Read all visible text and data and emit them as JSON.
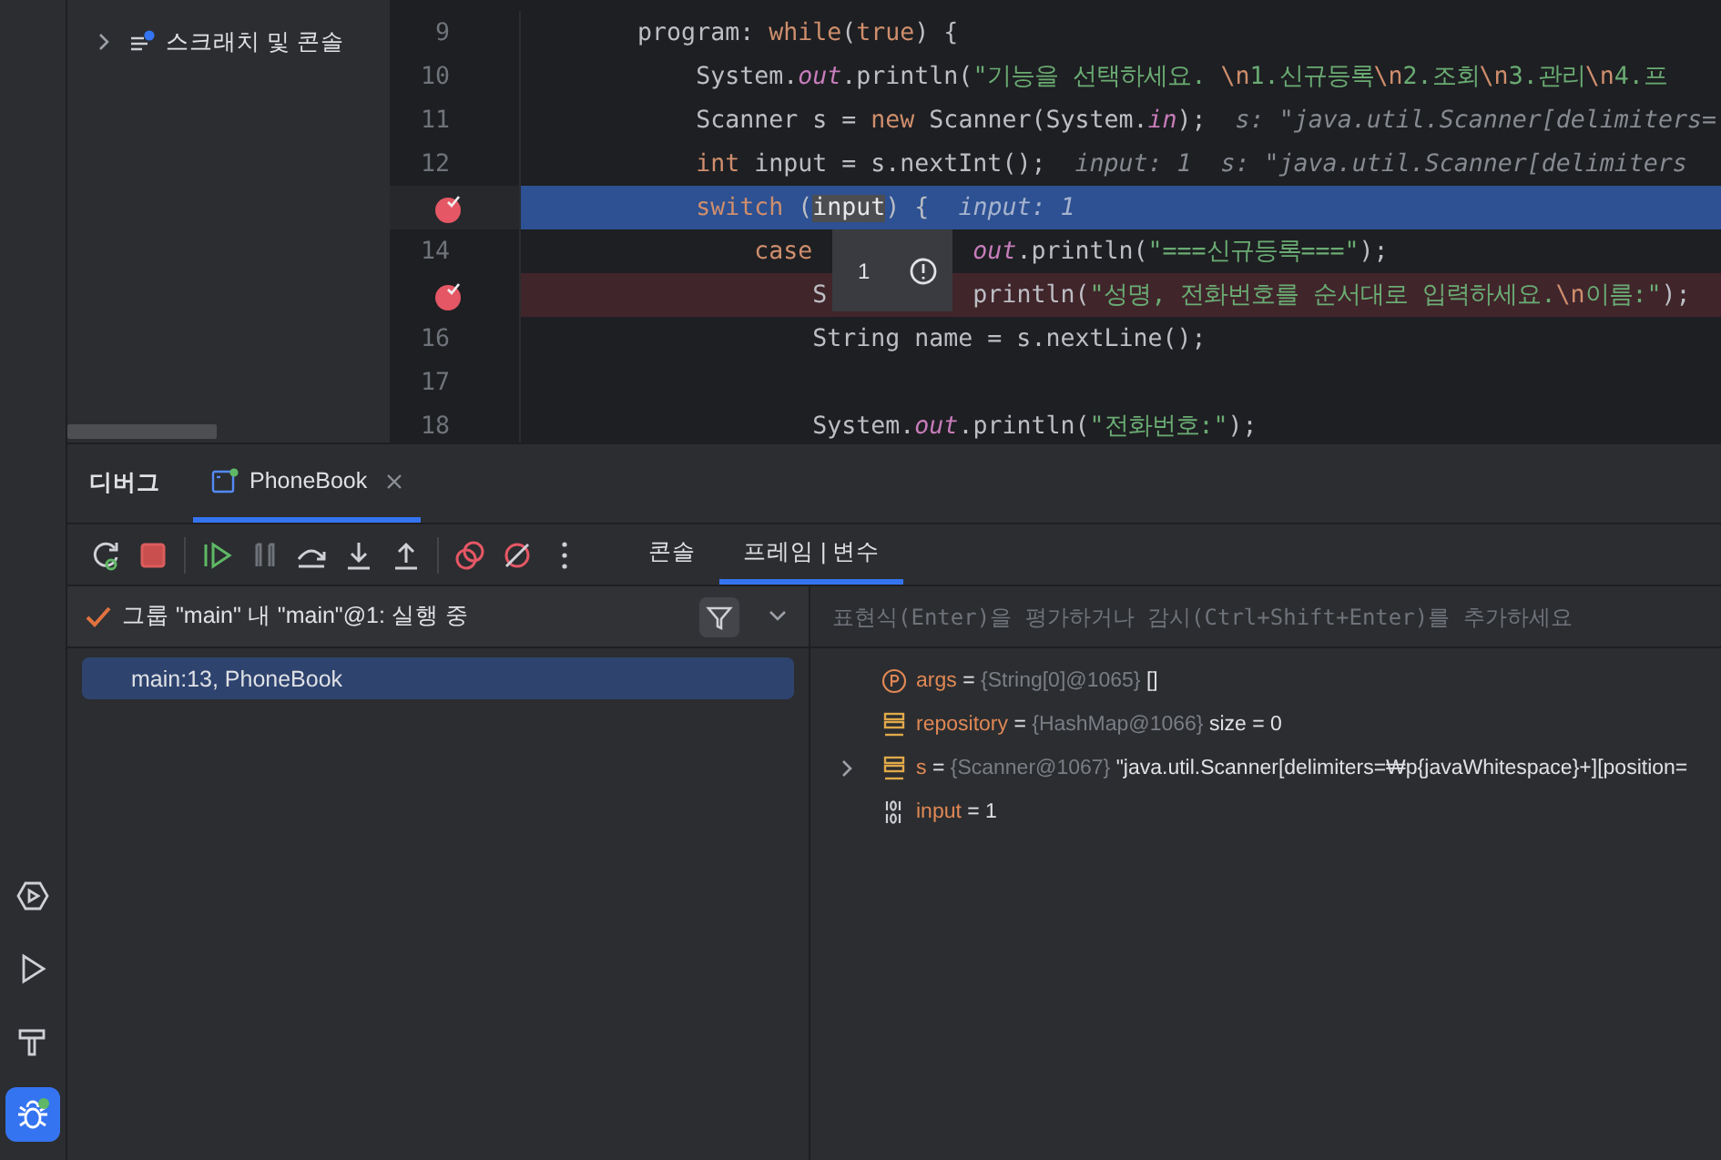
{
  "tool_strip": [
    {
      "kind": "services",
      "selected": false
    },
    {
      "kind": "run",
      "selected": false
    },
    {
      "kind": "build",
      "selected": false
    },
    {
      "kind": "debug",
      "selected": true
    }
  ],
  "project_tree": [
    {
      "label": "스크래치 및 콘솔",
      "kind": "scratch",
      "expanded": false
    }
  ],
  "editor": {
    "lines": [
      {
        "number": "9",
        "breakpoint": false,
        "execution_point": false,
        "tokens": [
          {
            "text": "        program: ",
            "kind": "plain"
          },
          {
            "text": "while",
            "kind": "keyword"
          },
          {
            "text": "(",
            "kind": "plain"
          },
          {
            "text": "true",
            "kind": "keyword"
          },
          {
            "text": ") {",
            "kind": "plain"
          }
        ]
      },
      {
        "number": "10",
        "breakpoint": false,
        "execution_point": false,
        "tokens": [
          {
            "text": "            System.",
            "kind": "plain"
          },
          {
            "text": "out",
            "kind": "field"
          },
          {
            "text": ".println(",
            "kind": "plain"
          },
          {
            "text": "\"기능을 선택하세요. ",
            "kind": "string"
          },
          {
            "text": "\\n",
            "kind": "escape"
          },
          {
            "text": "1.신규등록",
            "kind": "string"
          },
          {
            "text": "\\n",
            "kind": "escape"
          },
          {
            "text": "2.조회",
            "kind": "string"
          },
          {
            "text": "\\n",
            "kind": "escape"
          },
          {
            "text": "3.관리",
            "kind": "string"
          },
          {
            "text": "\\n",
            "kind": "escape"
          },
          {
            "text": "4.프",
            "kind": "string"
          }
        ]
      },
      {
        "number": "11",
        "breakpoint": false,
        "execution_point": false,
        "tokens": [
          {
            "text": "            Scanner s = ",
            "kind": "plain"
          },
          {
            "text": "new",
            "kind": "keyword"
          },
          {
            "text": " Scanner(System.",
            "kind": "plain"
          },
          {
            "text": "in",
            "kind": "field"
          },
          {
            "text": ");",
            "kind": "plain"
          },
          {
            "text": "s: \"java.util.Scanner[delimiters=",
            "kind": "hint"
          }
        ]
      },
      {
        "number": "12",
        "breakpoint": false,
        "execution_point": false,
        "tokens": [
          {
            "text": "            int",
            "kind": "keyword"
          },
          {
            "text": " input = s.nextInt();",
            "kind": "plain"
          },
          {
            "text": "input: 1",
            "kind": "hint"
          },
          {
            "text": "s: \"java.util.Scanner[delimiters",
            "kind": "hint"
          }
        ]
      },
      {
        "breakpoint": true,
        "execution_point": true,
        "tokens": [
          {
            "text": "            switch",
            "kind": "keyword"
          },
          {
            "text": " (",
            "kind": "plain"
          },
          {
            "text": "input",
            "kind": "hovered"
          },
          {
            "text": ") {",
            "kind": "plain"
          },
          {
            "text": "input: 1",
            "kind": "hint"
          }
        ]
      },
      {
        "number": "14",
        "breakpoint": false,
        "execution_point": false,
        "tokens": [
          {
            "text": "                case",
            "kind": "keyword"
          },
          {
            "text": "out",
            "kind": "field",
            "gap": true
          },
          {
            "text": ".println(",
            "kind": "plain"
          },
          {
            "text": "\"===신규등록===\"",
            "kind": "string"
          },
          {
            "text": ");",
            "kind": "plain"
          }
        ]
      },
      {
        "breakpoint": true,
        "execution_point": false,
        "tokens": [
          {
            "text": "                    S",
            "kind": "plain"
          },
          {
            "text": "println(",
            "kind": "plain",
            "gap": true
          },
          {
            "text": "\"성명, 전화번호를 순서대로 입력하세요.",
            "kind": "string"
          },
          {
            "text": "\\n",
            "kind": "escape"
          },
          {
            "text": "이름:\"",
            "kind": "string"
          },
          {
            "text": ");",
            "kind": "plain"
          }
        ]
      },
      {
        "number": "16",
        "breakpoint": false,
        "execution_point": false,
        "tokens": [
          {
            "text": "                    String name = s.nextLine();",
            "kind": "plain"
          }
        ]
      },
      {
        "number": "17",
        "breakpoint": false,
        "execution_point": false
      },
      {
        "number": "18",
        "breakpoint": false,
        "execution_point": false,
        "tokens": [
          {
            "text": "                    System.",
            "kind": "plain"
          },
          {
            "text": "out",
            "kind": "field"
          },
          {
            "text": ".println(",
            "kind": "plain"
          },
          {
            "text": "\"전화번호:\"",
            "kind": "string"
          },
          {
            "text": ");",
            "kind": "plain"
          }
        ]
      }
    ],
    "value_popup": {
      "value": "1"
    }
  },
  "debug_panel": {
    "title": "디버그",
    "session_tab": {
      "label": "PhoneBook",
      "selected": true
    },
    "toolbar": [
      {
        "kind": "rerun"
      },
      {
        "kind": "stop"
      },
      {
        "kind": "resume"
      },
      {
        "kind": "pause"
      },
      {
        "kind": "step-over"
      },
      {
        "kind": "step-into"
      },
      {
        "kind": "step-out"
      },
      {
        "kind": "breakpoints"
      },
      {
        "kind": "mute"
      },
      {
        "kind": "more"
      }
    ],
    "tabs": [
      {
        "label": "콘솔",
        "selected": false
      },
      {
        "label": "프레임 | 변수",
        "selected": true
      }
    ],
    "thread": "그룹 \"main\" 내 \"main\"@1: 실행 중",
    "frames": [
      {
        "label": "main:13, PhoneBook",
        "selected": true
      }
    ],
    "expression": {
      "placeholder": "표현식(Enter)을 평가하거나 감시(Ctrl+Shift+Enter)를 추가하세요"
    },
    "variables": [
      {
        "kind": "parameter",
        "expandable": false,
        "name": "args",
        "operator": "=",
        "type": "{String[0]@1065}",
        "value": "[]"
      },
      {
        "kind": "object",
        "expandable": false,
        "name": "repository",
        "operator": "=",
        "type": "{HashMap@1066}",
        "value": "size = 0"
      },
      {
        "kind": "object",
        "expandable": true,
        "name": "s",
        "operator": "=",
        "type": "{Scanner@1067}",
        "value": "\"java.util.Scanner[delimiters=₩p{javaWhitespace}+][position="
      },
      {
        "kind": "primitive",
        "expandable": false,
        "name": "input",
        "operator": "=",
        "value": "1"
      }
    ]
  }
}
